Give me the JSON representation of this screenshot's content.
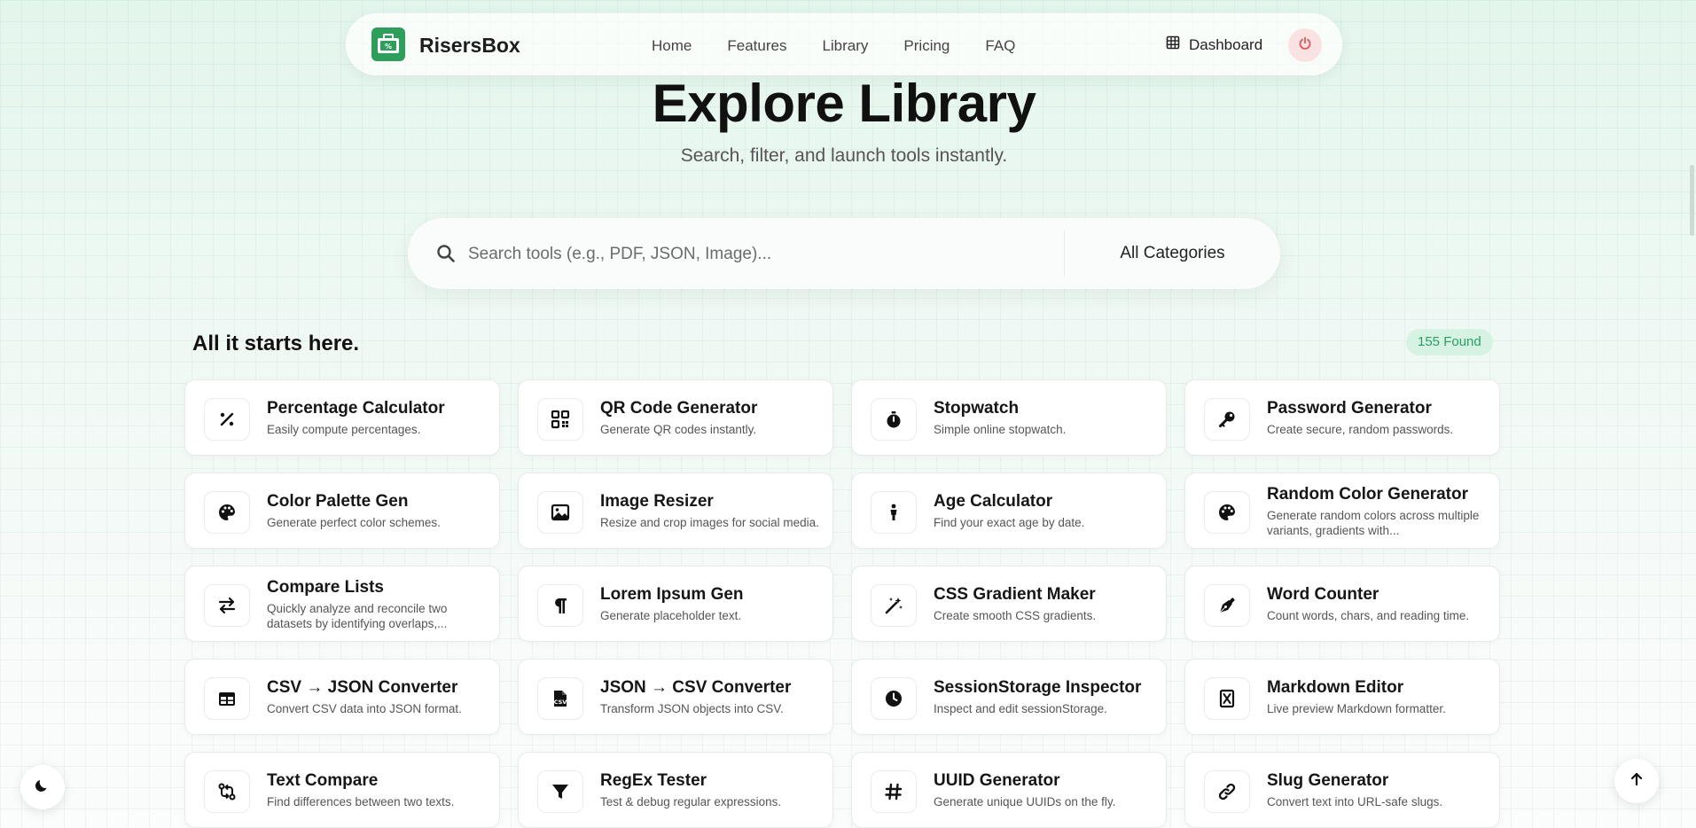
{
  "nav": {
    "brand": "RisersBox",
    "links": [
      "Home",
      "Features",
      "Library",
      "Pricing",
      "FAQ"
    ],
    "dashboard_label": "Dashboard"
  },
  "hero": {
    "title": "Explore Library",
    "subtitle": "Search, filter, and launch tools instantly."
  },
  "search": {
    "placeholder": "Search tools (e.g., PDF, JSON, Image)...",
    "value": "",
    "category": "All Categories"
  },
  "section": {
    "title": "All it starts here.",
    "found": "155 Found"
  },
  "tools": [
    {
      "title": "Percentage Calculator",
      "desc": "Easily compute percentages.",
      "icon": "percent-icon"
    },
    {
      "title": "QR Code Generator",
      "desc": "Generate QR codes instantly.",
      "icon": "qr-code-icon"
    },
    {
      "title": "Stopwatch",
      "desc": "Simple online stopwatch.",
      "icon": "stopwatch-icon"
    },
    {
      "title": "Password Generator",
      "desc": "Create secure, random passwords.",
      "icon": "key-icon"
    },
    {
      "title": "Color Palette Gen",
      "desc": "Generate perfect color schemes.",
      "icon": "palette-icon"
    },
    {
      "title": "Image Resizer",
      "desc": "Resize and crop images for social media.",
      "icon": "image-icon"
    },
    {
      "title": "Age Calculator",
      "desc": "Find your exact age by date.",
      "icon": "person-icon"
    },
    {
      "title": "Random Color Generator",
      "desc": "Generate random colors across multiple variants, gradients with...",
      "icon": "palette-icon"
    },
    {
      "title": "Compare Lists",
      "desc": "Quickly analyze and reconcile two datasets by identifying overlaps,...",
      "icon": "swap-arrows-icon"
    },
    {
      "title": "Lorem Ipsum Gen",
      "desc": "Generate placeholder text.",
      "icon": "paragraph-icon"
    },
    {
      "title": "CSS Gradient Maker",
      "desc": "Create smooth CSS gradients.",
      "icon": "magic-wand-icon"
    },
    {
      "title": "Word Counter",
      "desc": "Count words, chars, and reading time.",
      "icon": "pen-nib-icon"
    },
    {
      "title": "CSV → JSON Converter",
      "desc": "Convert CSV data into JSON format.",
      "icon": "table-icon"
    },
    {
      "title": "JSON → CSV Converter",
      "desc": "Transform JSON objects into CSV.",
      "icon": "csv-file-icon"
    },
    {
      "title": "SessionStorage Inspector",
      "desc": "Inspect and edit sessionStorage.",
      "icon": "clock-icon"
    },
    {
      "title": "Markdown Editor",
      "desc": "Live preview Markdown formatter.",
      "icon": "markdown-icon"
    },
    {
      "title": "Text Compare",
      "desc": "Find differences between two texts.",
      "icon": "diff-arrows-icon"
    },
    {
      "title": "RegEx Tester",
      "desc": "Test & debug regular expressions.",
      "icon": "filter-icon"
    },
    {
      "title": "UUID Generator",
      "desc": "Generate unique UUIDs on the fly.",
      "icon": "hash-icon"
    },
    {
      "title": "Slug Generator",
      "desc": "Convert text into URL-safe slugs.",
      "icon": "link-icon"
    }
  ],
  "colors": {
    "accent_green": "#2e9e5b",
    "badge_bg": "#d6f2e2",
    "badge_text": "#2a9e63",
    "power_bg": "#fbe2e2",
    "power_icon": "#e05555"
  }
}
